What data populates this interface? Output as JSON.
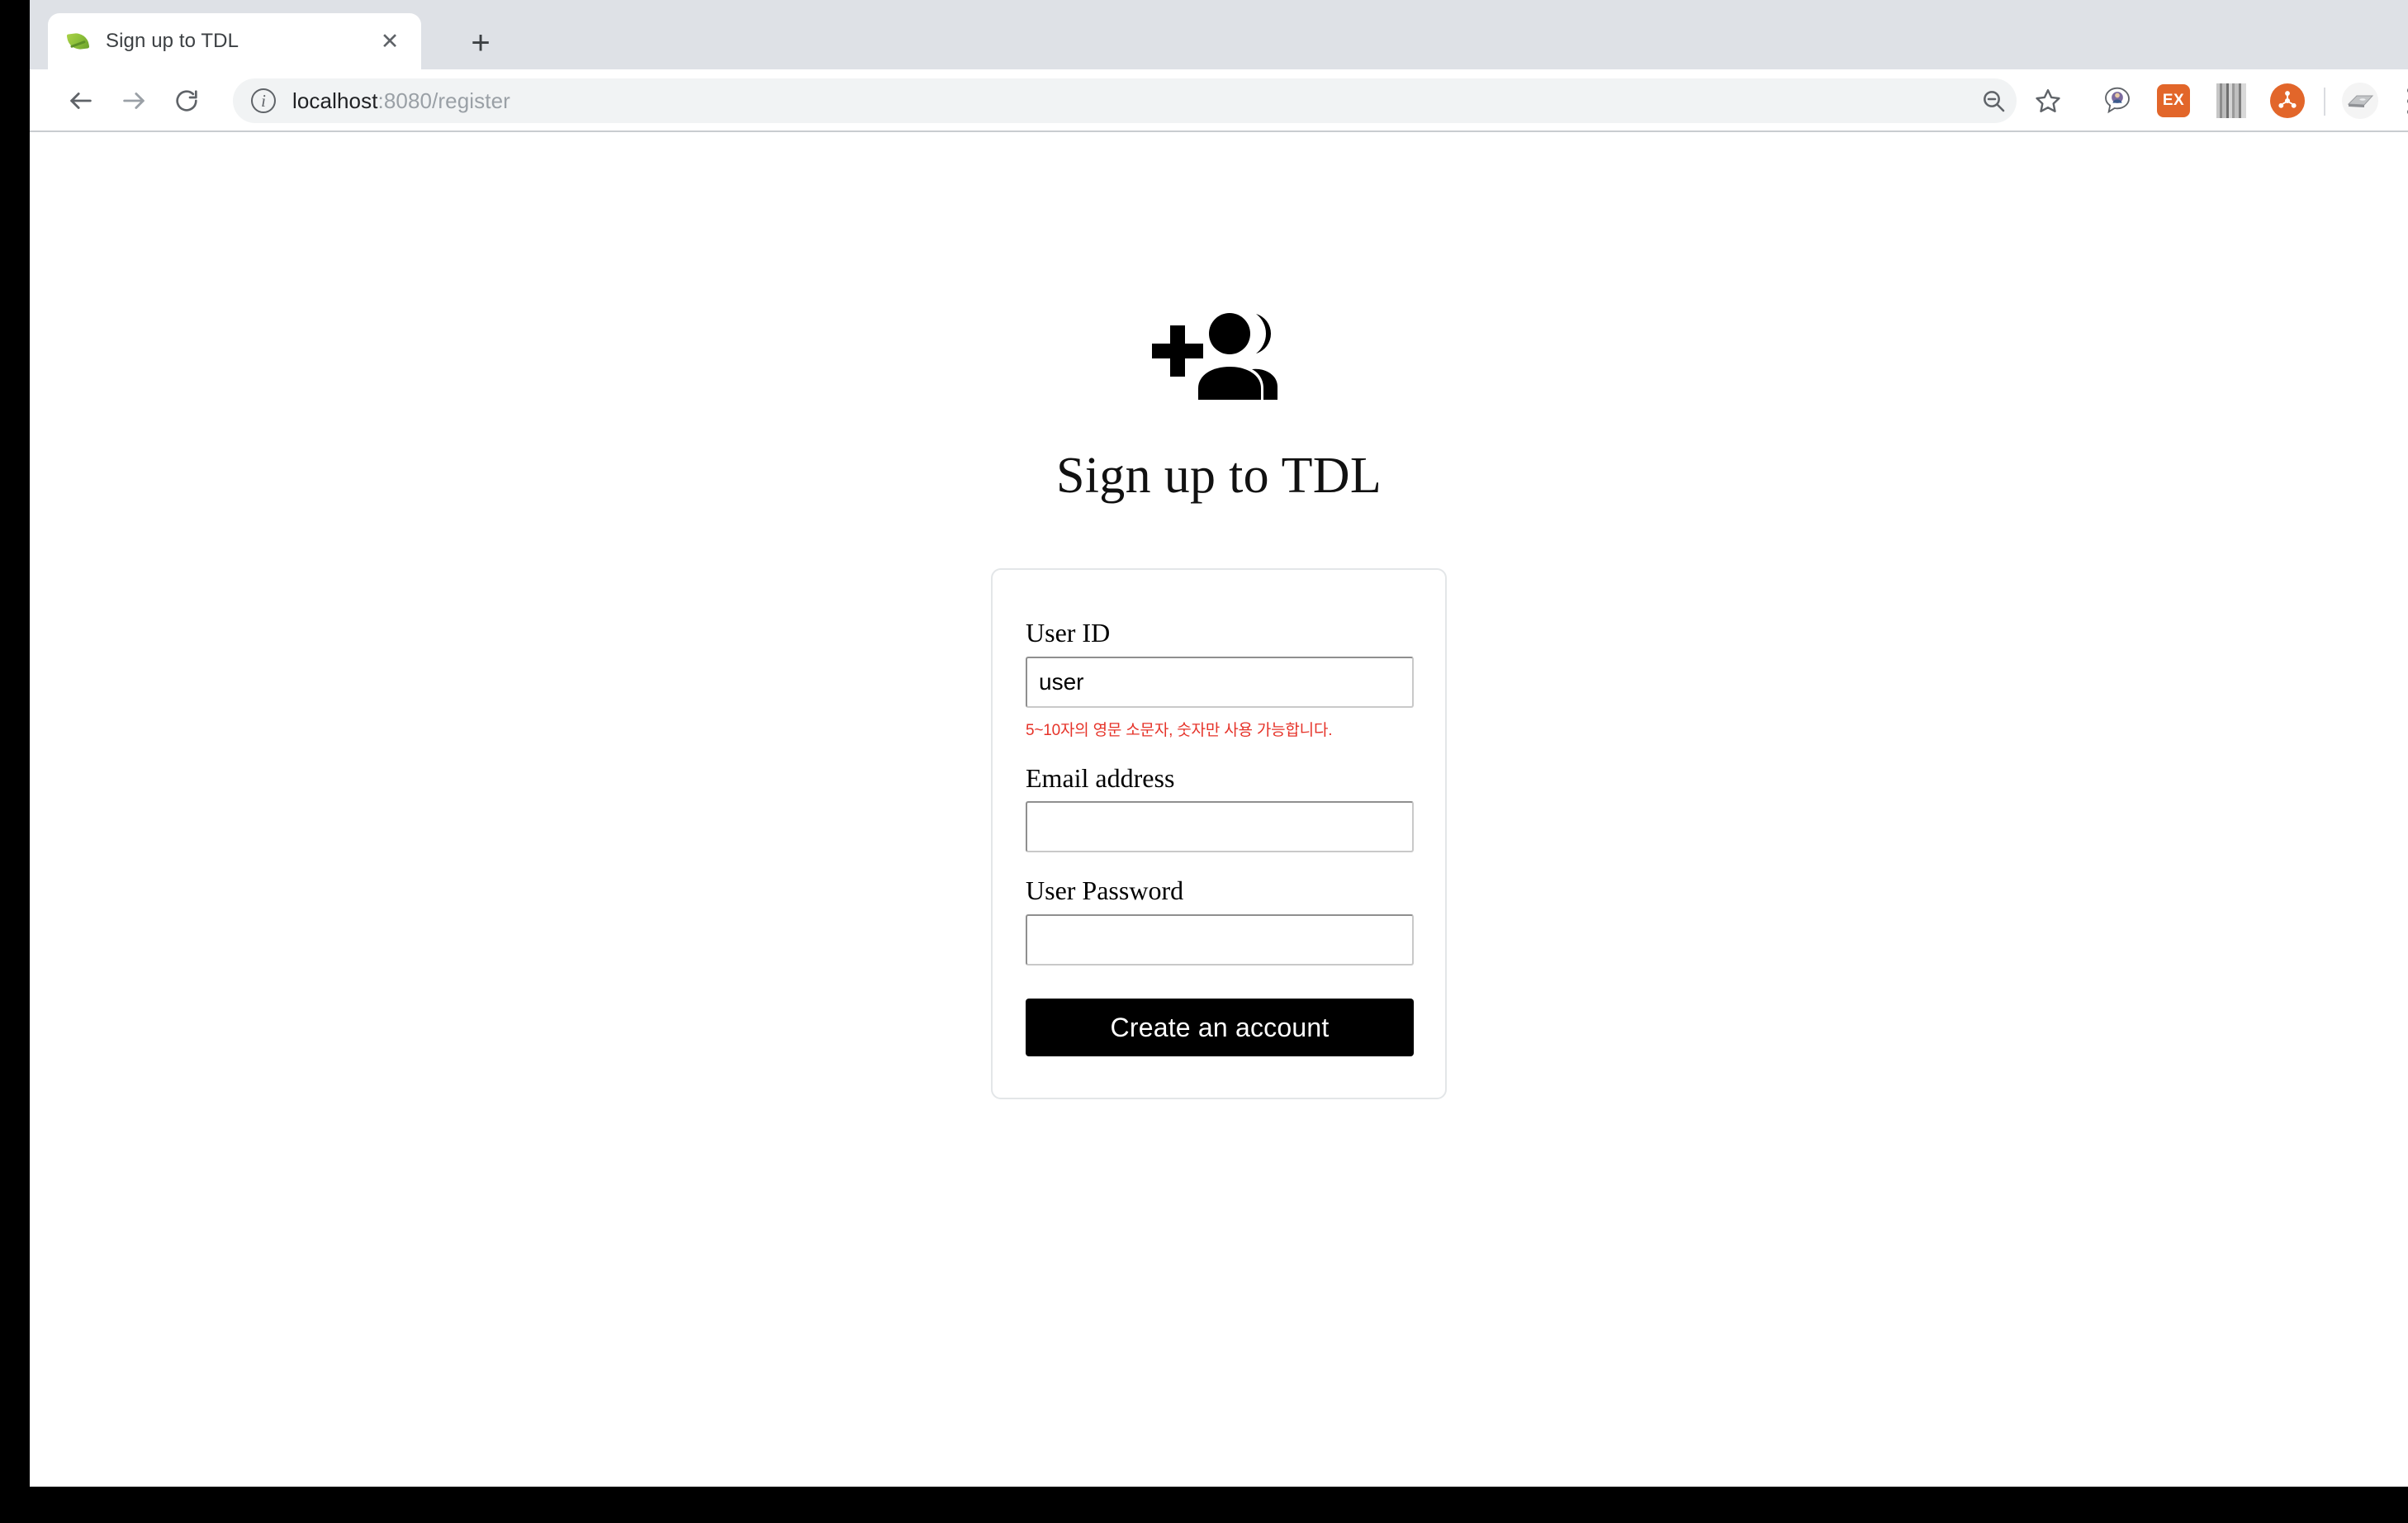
{
  "browser": {
    "tab": {
      "title": "Sign up to TDL",
      "favicon": "spring-leaf-icon",
      "close_label": "✕"
    },
    "new_tab_label": "+",
    "nav": {
      "back_label": "←",
      "forward_label": "→",
      "reload_label": "↻"
    },
    "omnibox": {
      "info_label": "i",
      "host": "localhost",
      "path": ":8080/register",
      "full_url": "localhost:8080/register"
    },
    "toolbar_icons": [
      {
        "name": "zoom-out-icon"
      },
      {
        "name": "bookmark-star-icon"
      },
      {
        "name": "speech-bubble-avatar-icon"
      },
      {
        "name": "ex-extension-icon",
        "label": "EX",
        "color": "#e2662a"
      },
      {
        "name": "stripes-extension-icon"
      },
      {
        "name": "orange-network-extension-icon",
        "color": "#e2662a"
      },
      {
        "name": "profile-avatar-icon"
      },
      {
        "name": "chrome-menu-icon"
      }
    ]
  },
  "page": {
    "hero_icon": "group-add-icon",
    "title": "Sign up to TDL",
    "form": {
      "user_id": {
        "label": "User ID",
        "value": "user",
        "placeholder": "",
        "error": "5~10자의 영문 소문자, 숫자만 사용 가능합니다.",
        "error_color": "#e63329"
      },
      "email": {
        "label": "Email address",
        "value": "",
        "placeholder": ""
      },
      "password": {
        "label": "User Password",
        "value": "",
        "placeholder": ""
      },
      "submit_label": "Create an account"
    }
  }
}
